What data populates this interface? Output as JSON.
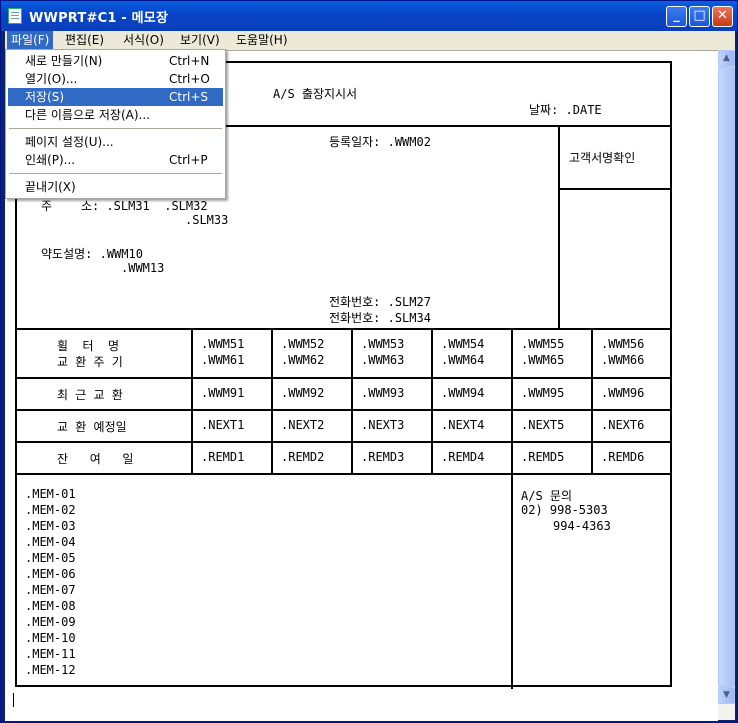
{
  "window": {
    "title": "WWPRT#C1 - 메모장",
    "minimize_label": "_",
    "maximize_label": "□",
    "close_label": "✕"
  },
  "menubar": [
    "파일(F)",
    "편집(E)",
    "서식(O)",
    "보기(V)",
    "도움말(H)"
  ],
  "file_menu": {
    "items": [
      {
        "label": "새로 만들기(N)",
        "shortcut": "Ctrl+N"
      },
      {
        "label": "열기(O)...",
        "shortcut": "Ctrl+O"
      },
      {
        "label": "저장(S)",
        "shortcut": "Ctrl+S"
      },
      {
        "label": "다른 이름으로 저장(A)...",
        "shortcut": ""
      },
      {
        "label": "페이지 설정(U)...",
        "shortcut": ""
      },
      {
        "label": "인쇄(P)...",
        "shortcut": "Ctrl+P"
      },
      {
        "label": "끝내기(X)",
        "shortcut": ""
      }
    ],
    "highlighted": "저장(S)"
  },
  "form": {
    "title": "A/S 출장지시서",
    "date": "날짜: .DATE",
    "reg_date": "등록일자: .WWM02",
    "customer_sign": "고객서명확인",
    "address_line1": "주    소: .SLM31  .SLM32",
    "address_line2": ".SLM33",
    "map_line1": "약도설명: .WWM10",
    "map_line2": ".WWM13",
    "phone1": "전화번호: .SLM27",
    "phone2": "전화번호: .SLM34",
    "rows": [
      {
        "label1": "휠  터  명",
        "label2": "교 환 주 기",
        "cells": [
          [
            ".WWM51",
            ".WWM61"
          ],
          [
            ".WWM52",
            ".WWM62"
          ],
          [
            ".WWM53",
            ".WWM63"
          ],
          [
            ".WWM54",
            ".WWM64"
          ],
          [
            ".WWM55",
            ".WWM65"
          ],
          [
            ".WWM56",
            ".WWM66"
          ]
        ]
      },
      {
        "label1": "최 근 교 환",
        "cells": [
          ".WWM91",
          ".WWM92",
          ".WWM93",
          ".WWM94",
          ".WWM95",
          ".WWM96"
        ]
      },
      {
        "label1": "교 환 예정일",
        "cells": [
          ".NEXT1",
          ".NEXT2",
          ".NEXT3",
          ".NEXT4",
          ".NEXT5",
          ".NEXT6"
        ]
      },
      {
        "label1": "잔   여   일",
        "cells": [
          ".REMD1",
          ".REMD2",
          ".REMD3",
          ".REMD4",
          ".REMD5",
          ".REMD6"
        ]
      }
    ],
    "memos": [
      ".MEM-01",
      ".MEM-02",
      ".MEM-03",
      ".MEM-04",
      ".MEM-05",
      ".MEM-06",
      ".MEM-07",
      ".MEM-08",
      ".MEM-09",
      ".MEM-10",
      ".MEM-11",
      ".MEM-12"
    ],
    "as_contact": {
      "title": "A/S 문의",
      "phone1": "02) 998-5303",
      "phone2": "994-4363"
    }
  }
}
